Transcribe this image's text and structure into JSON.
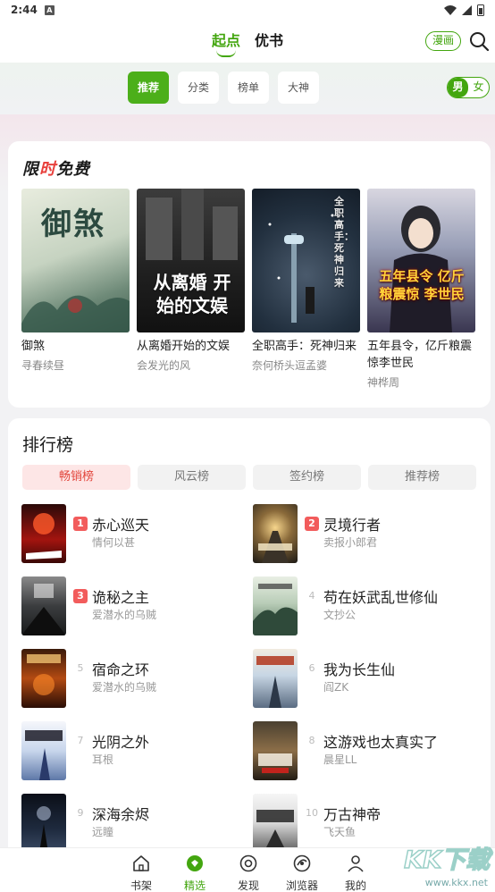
{
  "status_bar": {
    "time": "2:44",
    "notif_icon": "A"
  },
  "top_nav": {
    "tabs": [
      "起点",
      "优书"
    ],
    "manga_label": "漫画"
  },
  "sub_nav": {
    "chips": [
      "推荐",
      "分类",
      "榜单",
      "大神"
    ],
    "gender": [
      "男",
      "女"
    ]
  },
  "free_section": {
    "title_prefix": "限",
    "title_accent": "时",
    "title_suffix": "免费",
    "books": [
      {
        "title": "御煞",
        "author": "寻春续昼",
        "cover_text": "御煞"
      },
      {
        "title": "从离婚开始的文娱",
        "author": "会发光的风",
        "cover_text": "从离婚 开始的文娱"
      },
      {
        "title": "全职高手：死神归来",
        "author": "奈何桥头逗孟婆",
        "cover_text": "全职高手：死神归来"
      },
      {
        "title": "五年县令，亿斤粮震惊李世民",
        "author": "神桦周",
        "cover_text": "五年县令 亿斤粮震惊 李世民"
      }
    ]
  },
  "rank_section": {
    "title": "排行榜",
    "tabs": [
      "畅销榜",
      "风云榜",
      "签约榜",
      "推荐榜"
    ],
    "items": [
      {
        "rank": "1",
        "title": "赤心巡天",
        "author": "情何以甚"
      },
      {
        "rank": "2",
        "title": "灵境行者",
        "author": "卖报小郎君"
      },
      {
        "rank": "3",
        "title": "诡秘之主",
        "author": "爱潜水的乌贼"
      },
      {
        "rank": "4",
        "title": "苟在妖武乱世修仙",
        "author": "文抄公"
      },
      {
        "rank": "5",
        "title": "宿命之环",
        "author": "爱潜水的乌贼"
      },
      {
        "rank": "6",
        "title": "我为长生仙",
        "author": "阎ZK"
      },
      {
        "rank": "7",
        "title": "光阴之外",
        "author": "耳根"
      },
      {
        "rank": "8",
        "title": "这游戏也太真实了",
        "author": "晨星LL"
      },
      {
        "rank": "9",
        "title": "深海余烬",
        "author": "远瞳"
      },
      {
        "rank": "10",
        "title": "万古神帝",
        "author": "飞天鱼"
      }
    ]
  },
  "bottom_nav": {
    "items": [
      {
        "label": "书架",
        "icon": "home-icon"
      },
      {
        "label": "精选",
        "icon": "featured-icon"
      },
      {
        "label": "发现",
        "icon": "discover-icon"
      },
      {
        "label": "浏览器",
        "icon": "browser-icon"
      },
      {
        "label": "我的",
        "icon": "profile-icon"
      }
    ]
  },
  "watermark": {
    "text": "KK下载",
    "url": "www.kkx.net"
  },
  "colors": {
    "accent": "#43a60f",
    "rank_red": "#f25c5c"
  }
}
